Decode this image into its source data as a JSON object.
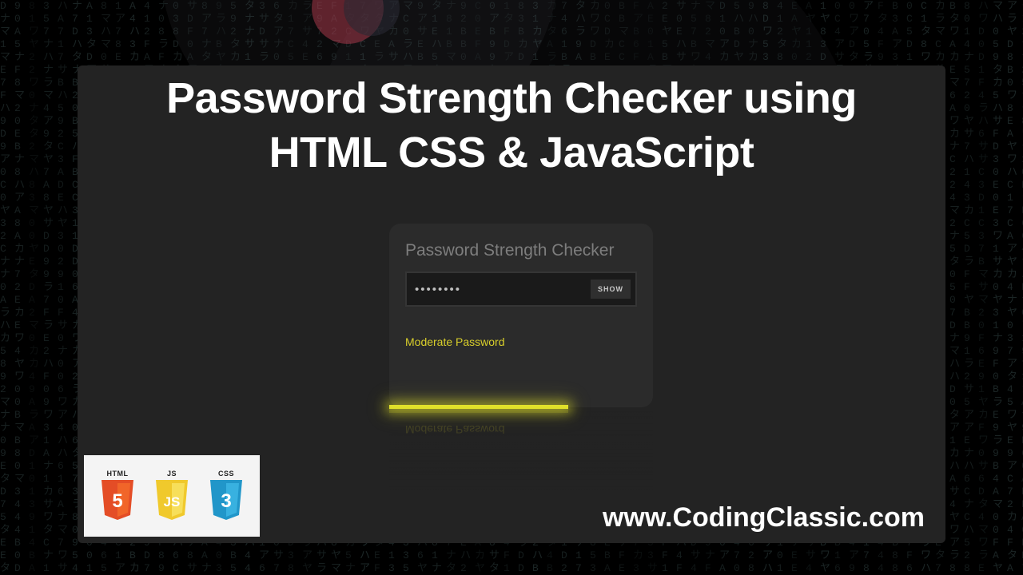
{
  "title_line1": "Password Strength Checker using",
  "title_line2": "HTML CSS & JavaScript",
  "checker": {
    "heading": "Password Strength Checker",
    "password_mask": "••••••••",
    "toggle_label": "SHOW",
    "strength_text": "Moderate Password",
    "strength_color": "#e0e02a",
    "strength_percent": 68
  },
  "badges": {
    "html": {
      "label": "HTML",
      "shield_text": "5",
      "color": "#e44d26"
    },
    "js": {
      "label": "JS",
      "shield_text": "JS",
      "color": "#f0c92c"
    },
    "css": {
      "label": "CSS",
      "shield_text": "3",
      "color": "#2196c9"
    }
  },
  "footer_url": "www.CodingClassic.com"
}
